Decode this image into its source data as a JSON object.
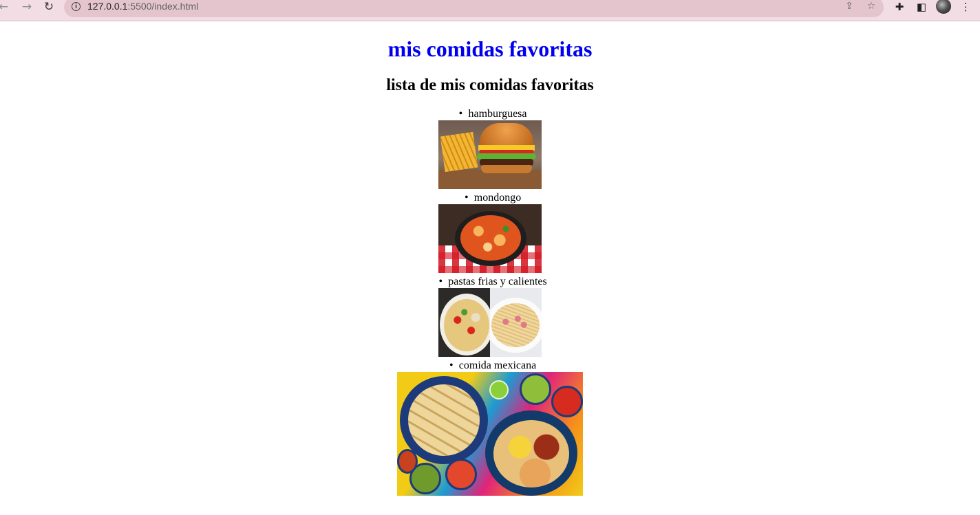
{
  "browser": {
    "url_host": "127.0.0.1",
    "url_path": ":5500/index.html"
  },
  "page": {
    "title": "mis comidas favoritas",
    "subtitle": "lista de mis comidas favoritas",
    "items": [
      {
        "label": "hamburguesa"
      },
      {
        "label": "mondongo"
      },
      {
        "label": "pastas frias y calientes"
      },
      {
        "label": "comida mexicana"
      }
    ]
  },
  "colors": {
    "title": "#0000ee",
    "chrome_bg": "#f1dde3"
  }
}
